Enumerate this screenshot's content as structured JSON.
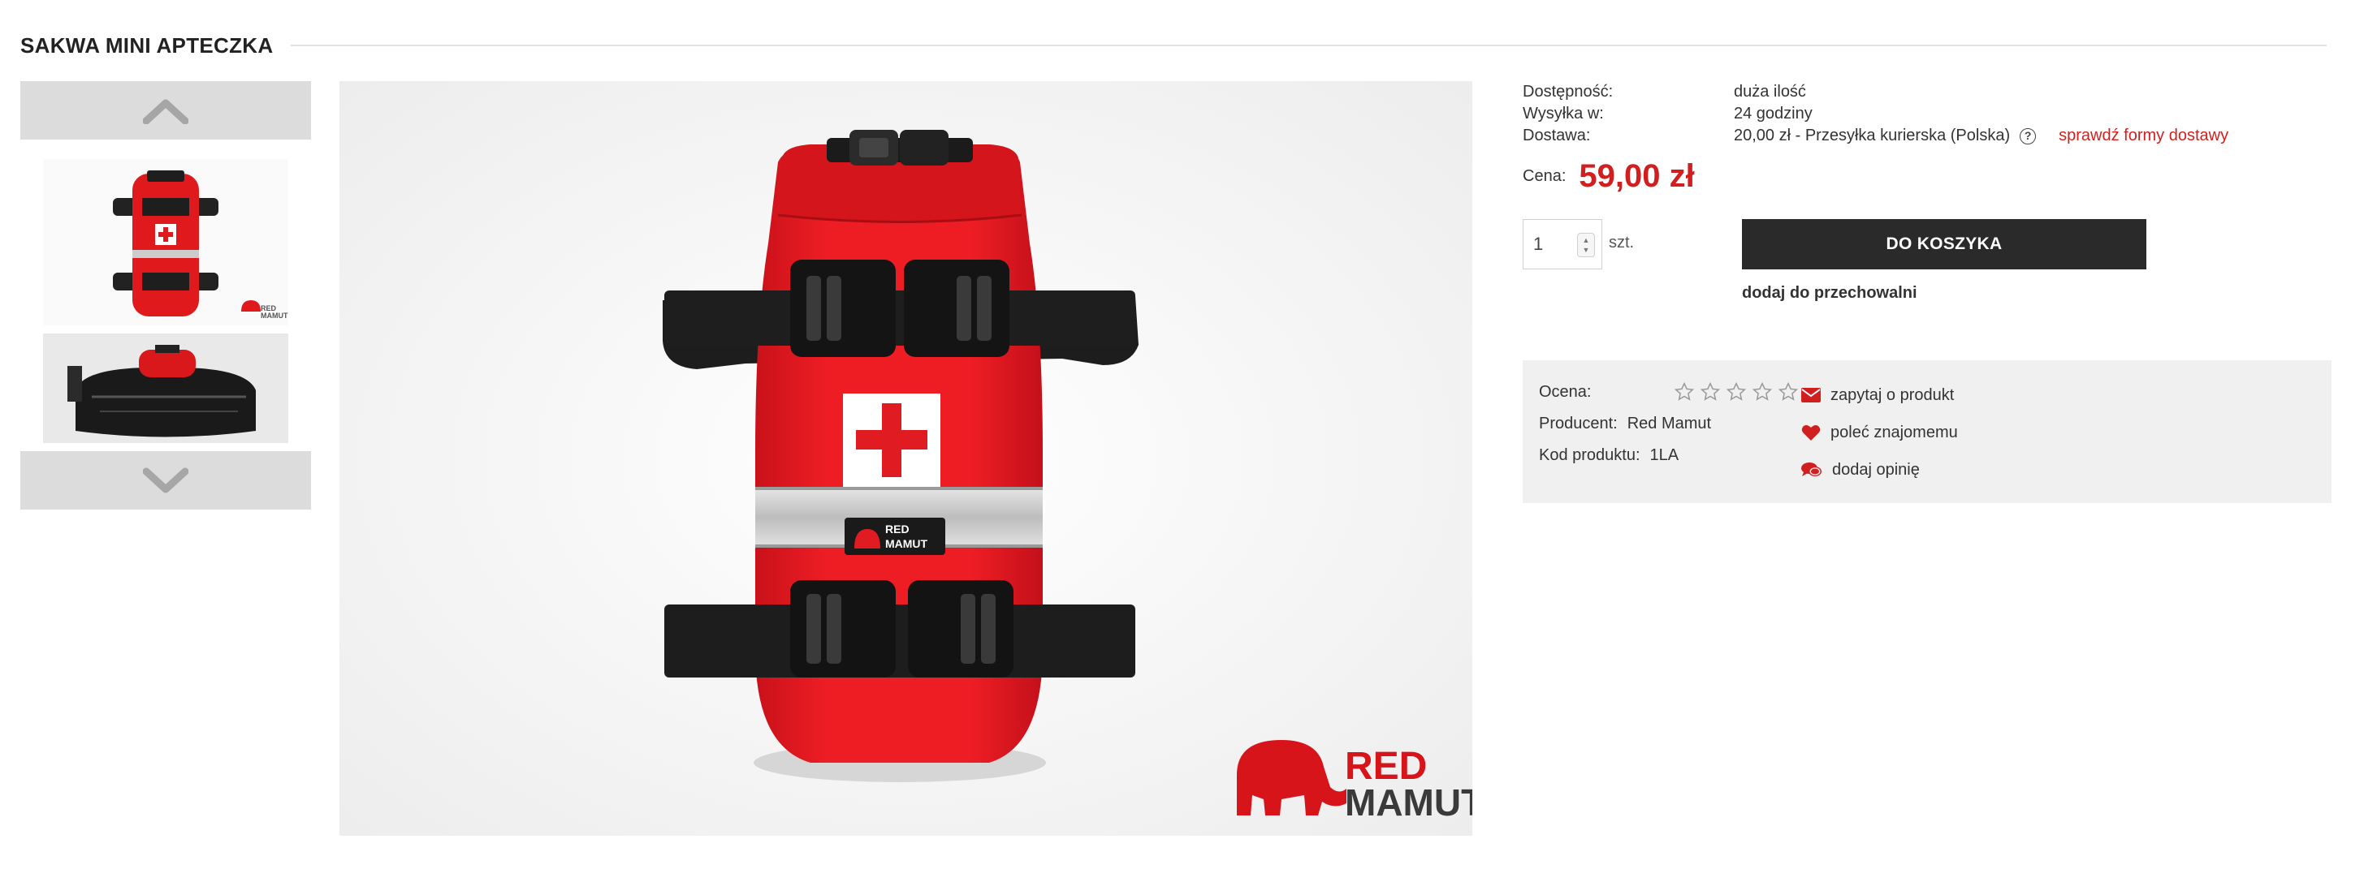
{
  "product": {
    "title": "SAKWA MINI APTECZKA"
  },
  "gallery": {
    "up_arrow_icon": "chevron-up-icon",
    "down_arrow_icon": "chevron-down-icon",
    "thumb_brand_line1": "RED",
    "thumb_brand_line2": "MAMUT",
    "main_logo_line1": "RED",
    "main_logo_line2": "MAMUT",
    "patch_line1": "RED",
    "patch_line2": "MAMUT"
  },
  "availability": {
    "rows": [
      {
        "label": "Dostępność:",
        "value": "duża ilość"
      },
      {
        "label": "Wysyłka w:",
        "value": "24 godziny"
      },
      {
        "label": "Dostawa:",
        "value": "20,00 zł - Przesyłka kurierska (Polska)"
      }
    ],
    "help_icon": "question-circle-icon",
    "help_glyph": "?",
    "delivery_link": "sprawdź formy dostawy"
  },
  "price": {
    "label": "Cena:",
    "value": "59,00 zł"
  },
  "cart": {
    "quantity": "1",
    "unit": "szt.",
    "button": "DO KOSZYKA",
    "storage_link": "dodaj do przechowalni"
  },
  "details": {
    "rating_label": "Ocena:",
    "rating_value": 0,
    "rating_max": 5,
    "producer_label": "Producent:",
    "producer_value": "Red Mamut",
    "code_label": "Kod produktu:",
    "code_value": "1LA",
    "links": [
      {
        "label": "zapytaj o produkt",
        "icon": "envelope-icon"
      },
      {
        "label": "poleć znajomemu",
        "icon": "heart-icon"
      },
      {
        "label": "dodaj opinię",
        "icon": "comments-icon"
      }
    ]
  },
  "colors": {
    "accent_red": "#d11f1f",
    "button_dark": "#2a2a2a",
    "panel_bg": "#f0f0f0",
    "arrow_bg": "#dcdcdc"
  }
}
